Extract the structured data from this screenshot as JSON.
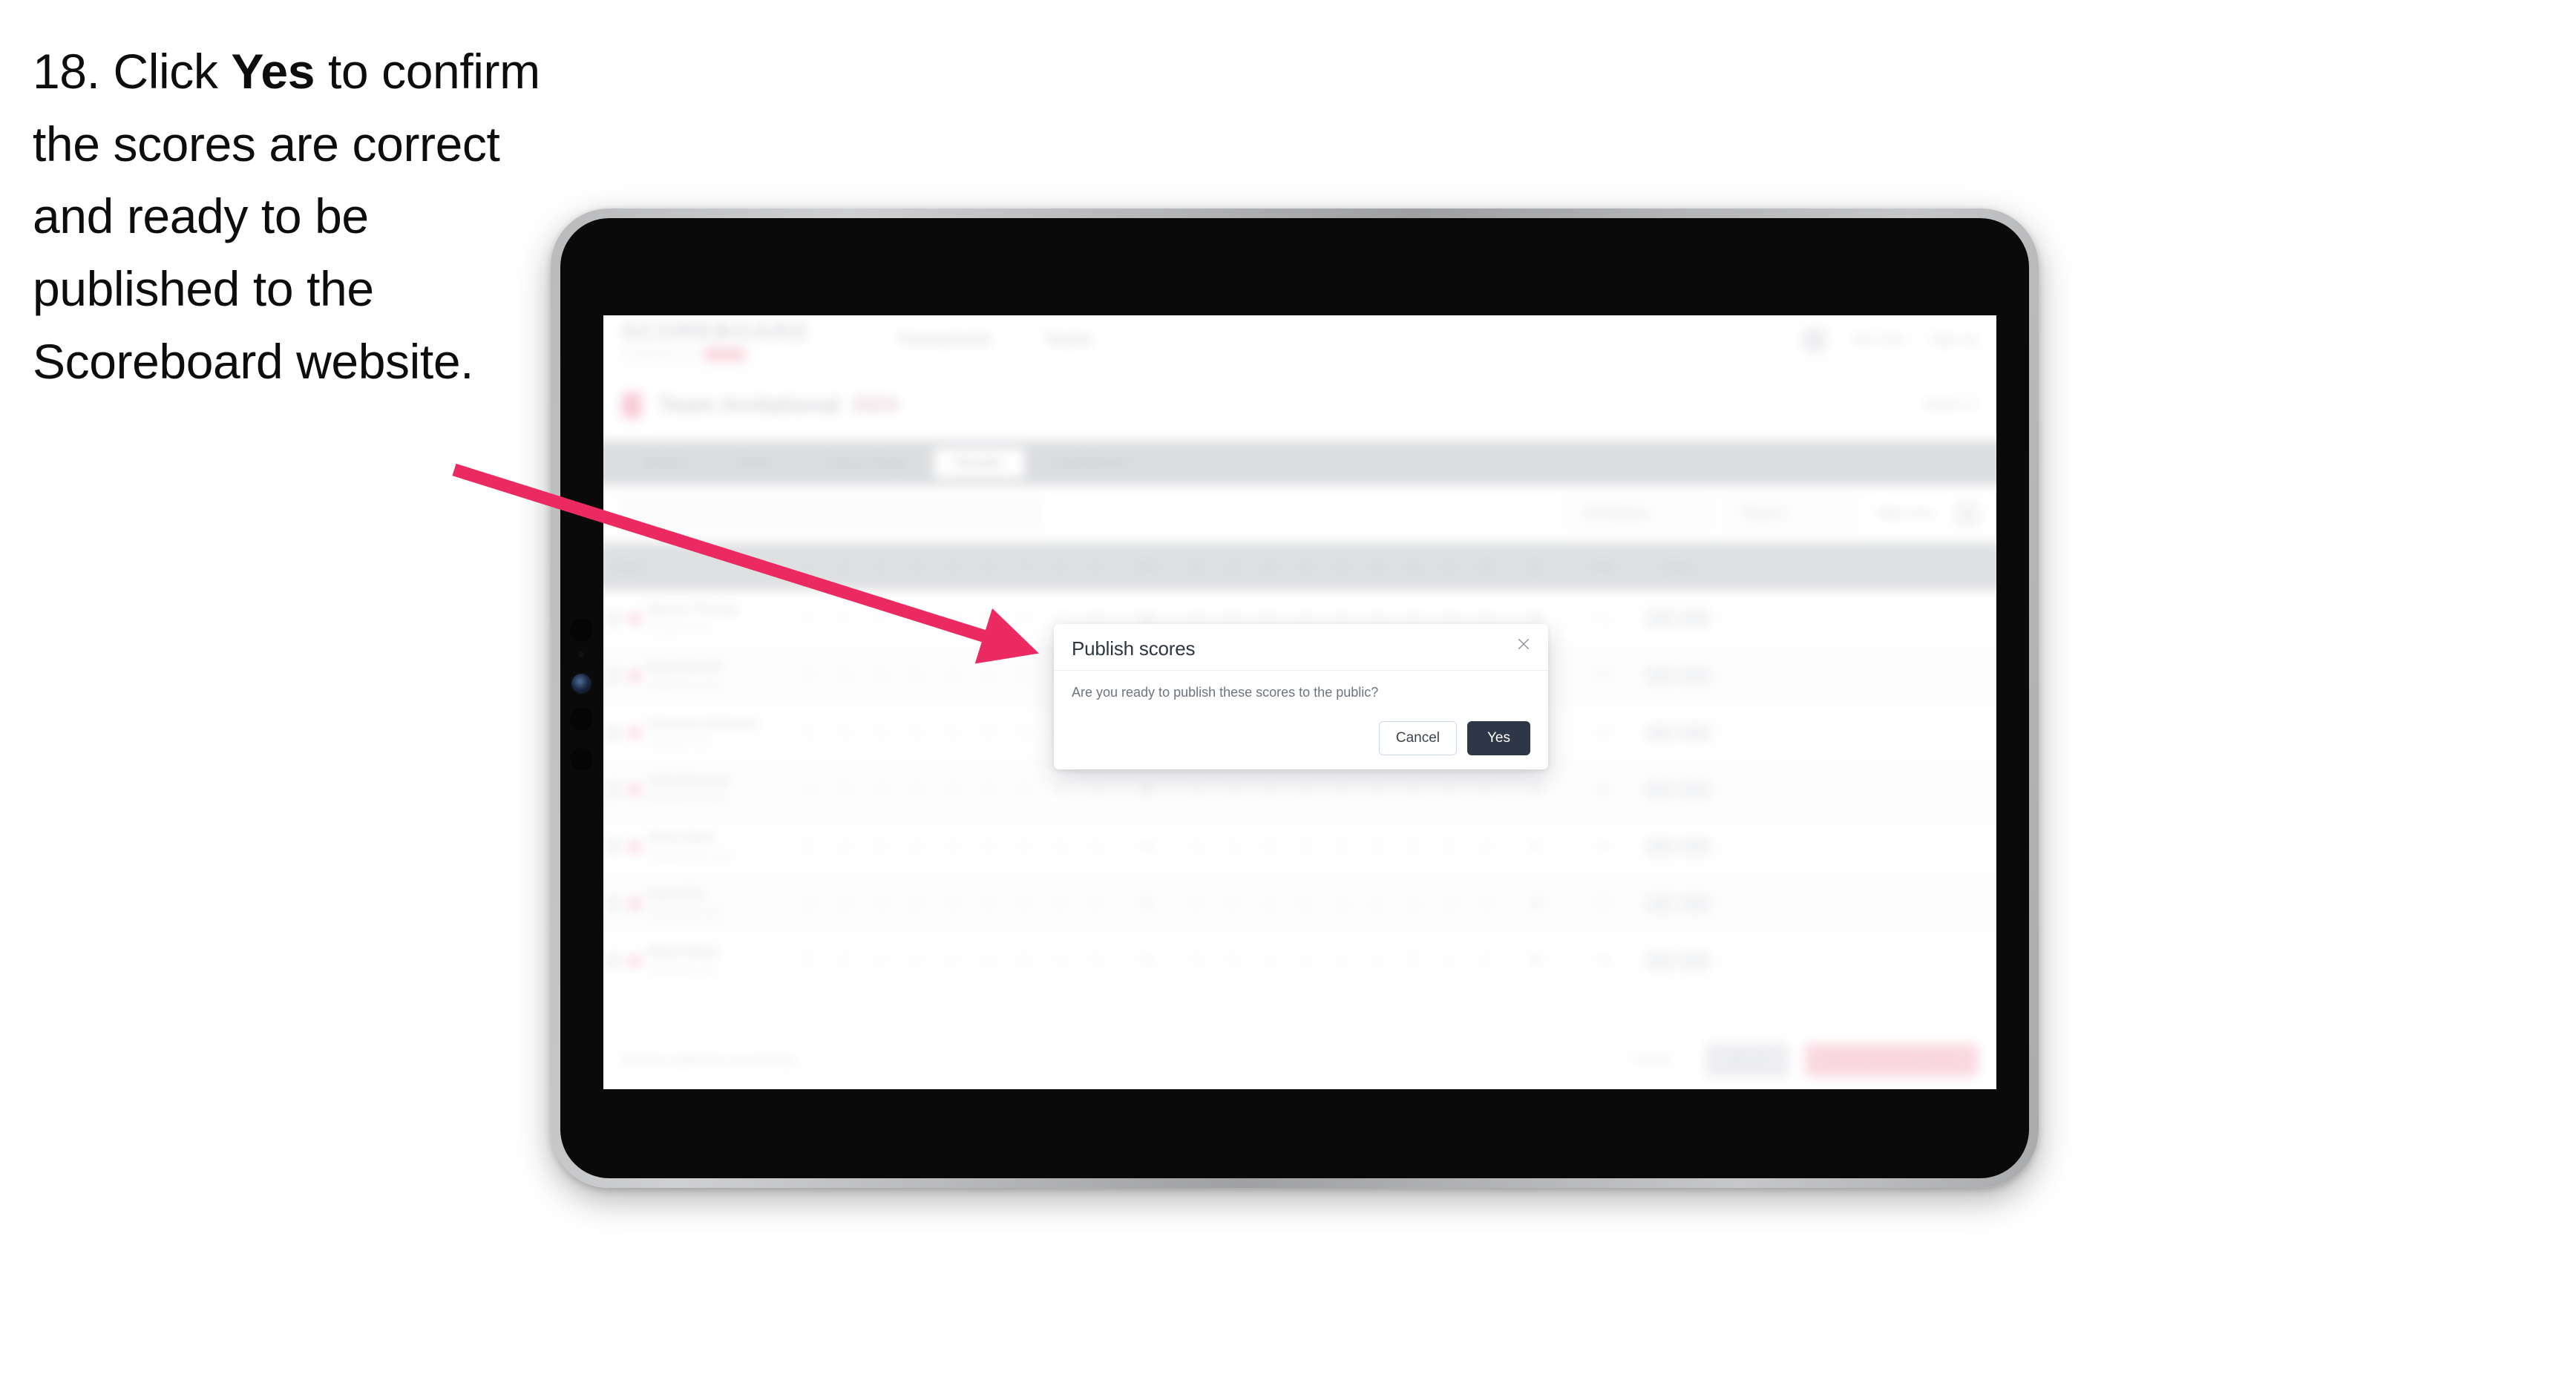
{
  "instruction": {
    "number": "18.",
    "part1": "Click ",
    "emphasis": "Yes",
    "part2": " to confirm the scores are correct and ready to be published to the Scoreboard website."
  },
  "annotation": {
    "arrow_color": "#EC2A62",
    "arrow_name": "pointer-arrow"
  },
  "device": {
    "type": "tablet",
    "bezel_color": "#b9babc",
    "screen_bg": "#0a0a0a"
  },
  "app": {
    "header": {
      "brand": "SCOREBOARD",
      "brand_sub": "POWERED BY",
      "brand_chip": "GOLF",
      "nav": [
        "Tournaments",
        "Teams"
      ],
      "user": "Test User",
      "signout": "Sign out"
    },
    "title_bar": {
      "event_name": "Team Invitational",
      "event_year": "2024",
      "right_label": "Week 12"
    },
    "tabs": [
      {
        "label": "Details",
        "active": false
      },
      {
        "label": "Teams",
        "active": false
      },
      {
        "label": "Course Setup",
        "active": false
      },
      {
        "label": "Results",
        "active": true
      },
      {
        "label": "Leaderboard",
        "active": false
      }
    ],
    "toolbar": {
      "search_placeholder": "Search",
      "filters": [
        "All Divisions",
        "Round 1"
      ],
      "view_label": "Table View"
    },
    "table": {
      "columns": {
        "player": "Player",
        "holes": [
          "1",
          "2",
          "3",
          "4",
          "5",
          "6",
          "7",
          "8",
          "9",
          "OUT",
          "10",
          "11",
          "12",
          "13",
          "14",
          "15",
          "16",
          "17",
          "18"
        ],
        "in": "IN",
        "total": "Total",
        "action": "Action"
      },
      "rows": [
        {
          "name": "Marcus Thomas",
          "club": "Eastside Club",
          "scores": [
            "4",
            "3",
            "5",
            "4",
            "3",
            "4",
            "5",
            "4",
            "4"
          ],
          "out": "36",
          "in": "35",
          "total": "71",
          "par": "-1"
        },
        {
          "name": "Ryan Parrish",
          "club": "Northwood Links",
          "scores": [
            "5",
            "4",
            "4",
            "3",
            "4",
            "4",
            "5",
            "4",
            "4"
          ],
          "out": "37",
          "in": "36",
          "total": "73",
          "par": "+1"
        },
        {
          "name": "Cameron Anderson",
          "club": "Lakeview Golf",
          "scores": [
            "4",
            "4",
            "5",
            "4",
            "4",
            "3",
            "5",
            "5",
            "4"
          ],
          "out": "38",
          "in": "36",
          "total": "74",
          "par": "+2"
        },
        {
          "name": "Jack Donovan",
          "club": "Riverbend Country",
          "scores": [
            "4",
            "5",
            "4",
            "4",
            "3",
            "4",
            "5",
            "4",
            "5"
          ],
          "out": "38",
          "in": "37",
          "total": "75",
          "par": "+3"
        },
        {
          "name": "Oliver Ward",
          "club": "Highland Park Club",
          "scores": [
            "5",
            "4",
            "5",
            "4",
            "4",
            "4",
            "4",
            "5",
            "4"
          ],
          "out": "39",
          "in": "37",
          "total": "76",
          "par": "+4"
        },
        {
          "name": "Noah Kim",
          "club": "Stonebridge Golf",
          "scores": [
            "4",
            "4",
            "4",
            "5",
            "4",
            "5",
            "5",
            "4",
            "4"
          ],
          "out": "39",
          "in": "38",
          "total": "77",
          "par": "+5"
        },
        {
          "name": "Ethan Bailey",
          "club": "Greenfield Links",
          "scores": [
            "5",
            "5",
            "4",
            "4",
            "4",
            "4",
            "5",
            "4",
            "5"
          ],
          "out": "40",
          "in": "38",
          "total": "78",
          "par": "+6"
        }
      ]
    },
    "footer": {
      "note": "Results published successfully",
      "cancel": "Cancel",
      "save": "Save All",
      "publish": "Publish Scores to Public"
    }
  },
  "modal": {
    "title": "Publish scores",
    "message": "Are you ready to publish these scores to the public?",
    "cancel_label": "Cancel",
    "confirm_label": "Yes",
    "close_icon": "close-icon",
    "confirm_color": "#2d3748"
  }
}
